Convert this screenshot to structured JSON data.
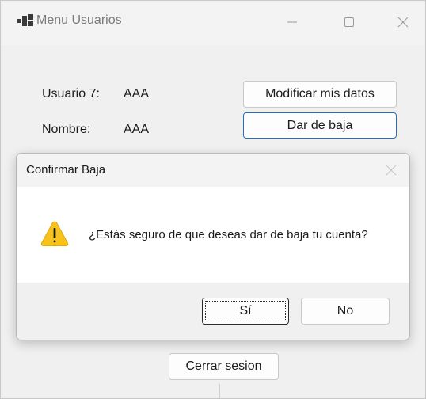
{
  "window": {
    "title": "Menu Usuarios"
  },
  "user_info": {
    "usuario_label": "Usuario 7:",
    "usuario_value": "AAA",
    "nombre_label": "Nombre:",
    "nombre_value": "AAA"
  },
  "actions": {
    "modificar_label": "Modificar mis datos",
    "baja_label": "Dar de baja",
    "cerrar_label": "Cerrar sesion"
  },
  "dialog": {
    "title": "Confirmar Baja",
    "message": "¿Estás seguro de que deseas dar de baja tu cuenta?",
    "yes_label": "Sí",
    "no_label": "No"
  },
  "icons": {
    "app": "app-icon",
    "minimize": "minimize-icon",
    "maximize": "maximize-icon",
    "close": "close-icon",
    "warning": "warning-icon"
  },
  "colors": {
    "warning_fill": "#f7c21b",
    "focus_border": "#1f6fc2",
    "window_bg": "#f0f0f0",
    "dialog_body_bg": "#ffffff"
  }
}
